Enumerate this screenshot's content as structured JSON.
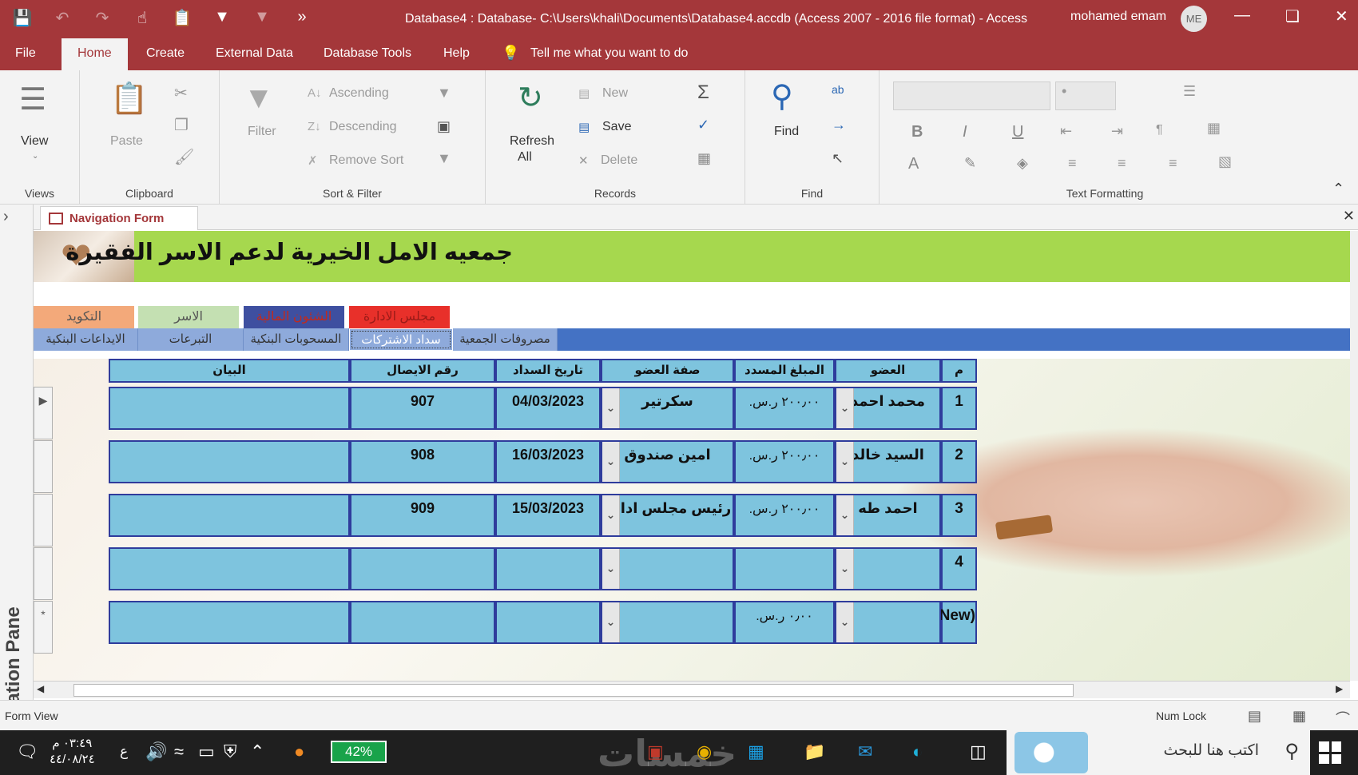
{
  "window": {
    "title": "Database4 : Database- C:\\Users\\khali\\Documents\\Database4.accdb (Access 2007 - 2016 file format)  -  Access",
    "user": "mohamed emam",
    "avatar_initials": "ME"
  },
  "menu": {
    "file": "File",
    "home": "Home",
    "create": "Create",
    "external": "External Data",
    "dbtools": "Database Tools",
    "help": "Help",
    "tell": "Tell me what you want to do"
  },
  "ribbon": {
    "views": {
      "view": "View",
      "label": "Views"
    },
    "clipboard": {
      "paste": "Paste",
      "label": "Clipboard"
    },
    "sort": {
      "filter": "Filter",
      "ascending": "Ascending",
      "descending": "Descending",
      "remove_sort": "Remove Sort",
      "label": "Sort & Filter"
    },
    "records": {
      "refresh": "Refresh",
      "all": "All",
      "new": "New",
      "save": "Save",
      "delete": "Delete",
      "label": "Records"
    },
    "find": {
      "find": "Find",
      "label": "Find"
    },
    "text": {
      "label": "Text Formatting"
    }
  },
  "nav_pane": "Navigation Pane",
  "doc_tab": "Navigation Form",
  "form": {
    "title": "جمعيه الامل الخيرية لدعم الاسر الفقيرة",
    "top_tabs": [
      "مجلس الادارة",
      "الشئون المالية",
      "الاسر",
      "التكويد"
    ],
    "sub_tabs": [
      "مصروفات الجمعية",
      "سداد الاشتركات",
      "المسحوبات البنكية",
      "التبرعات",
      "الايداعات البنكية"
    ],
    "columns": [
      "م",
      "العضو",
      "المبلغ المسدد",
      "صفة العضو",
      "تاريخ السداد",
      "رقم الايصال",
      "البيان"
    ],
    "rows": [
      {
        "no": "1",
        "member": "محمد احمد",
        "amount": "٢٠٠٫٠٠ ر.س.",
        "role": "سكرتير",
        "date": "04/03/2023",
        "receipt": "907",
        "note": ""
      },
      {
        "no": "2",
        "member": "السيد خالد",
        "amount": "٢٠٠٫٠٠ ر.س.",
        "role": "امين صندوق",
        "date": "16/03/2023",
        "receipt": "908",
        "note": ""
      },
      {
        "no": "3",
        "member": "احمد طه",
        "amount": "٢٠٠٫٠٠ ر.س.",
        "role": "رئيس مجلس ادارة",
        "date": "15/03/2023",
        "receipt": "909",
        "note": ""
      },
      {
        "no": "4",
        "member": "",
        "amount": "",
        "role": "",
        "date": "",
        "receipt": "",
        "note": ""
      },
      {
        "no": "(New)",
        "member": "",
        "amount": "٠٫٠٠ ر.س.",
        "role": "",
        "date": "",
        "receipt": "",
        "note": ""
      }
    ]
  },
  "status": {
    "left": "Form View",
    "numlock": "Num Lock"
  },
  "taskbar": {
    "clock_time": "٠٣:٤٩ م",
    "clock_date": "٤٤/٠٨/٢٤",
    "battery": "42%",
    "lang": "ع",
    "search": "اكتب هنا للبحث",
    "watermark": "خمسات"
  },
  "colors": {
    "accent": "#a4373a",
    "header_green": "#a6d84e",
    "sub_bar": "#4472c4",
    "cell": "#7ec4de"
  }
}
